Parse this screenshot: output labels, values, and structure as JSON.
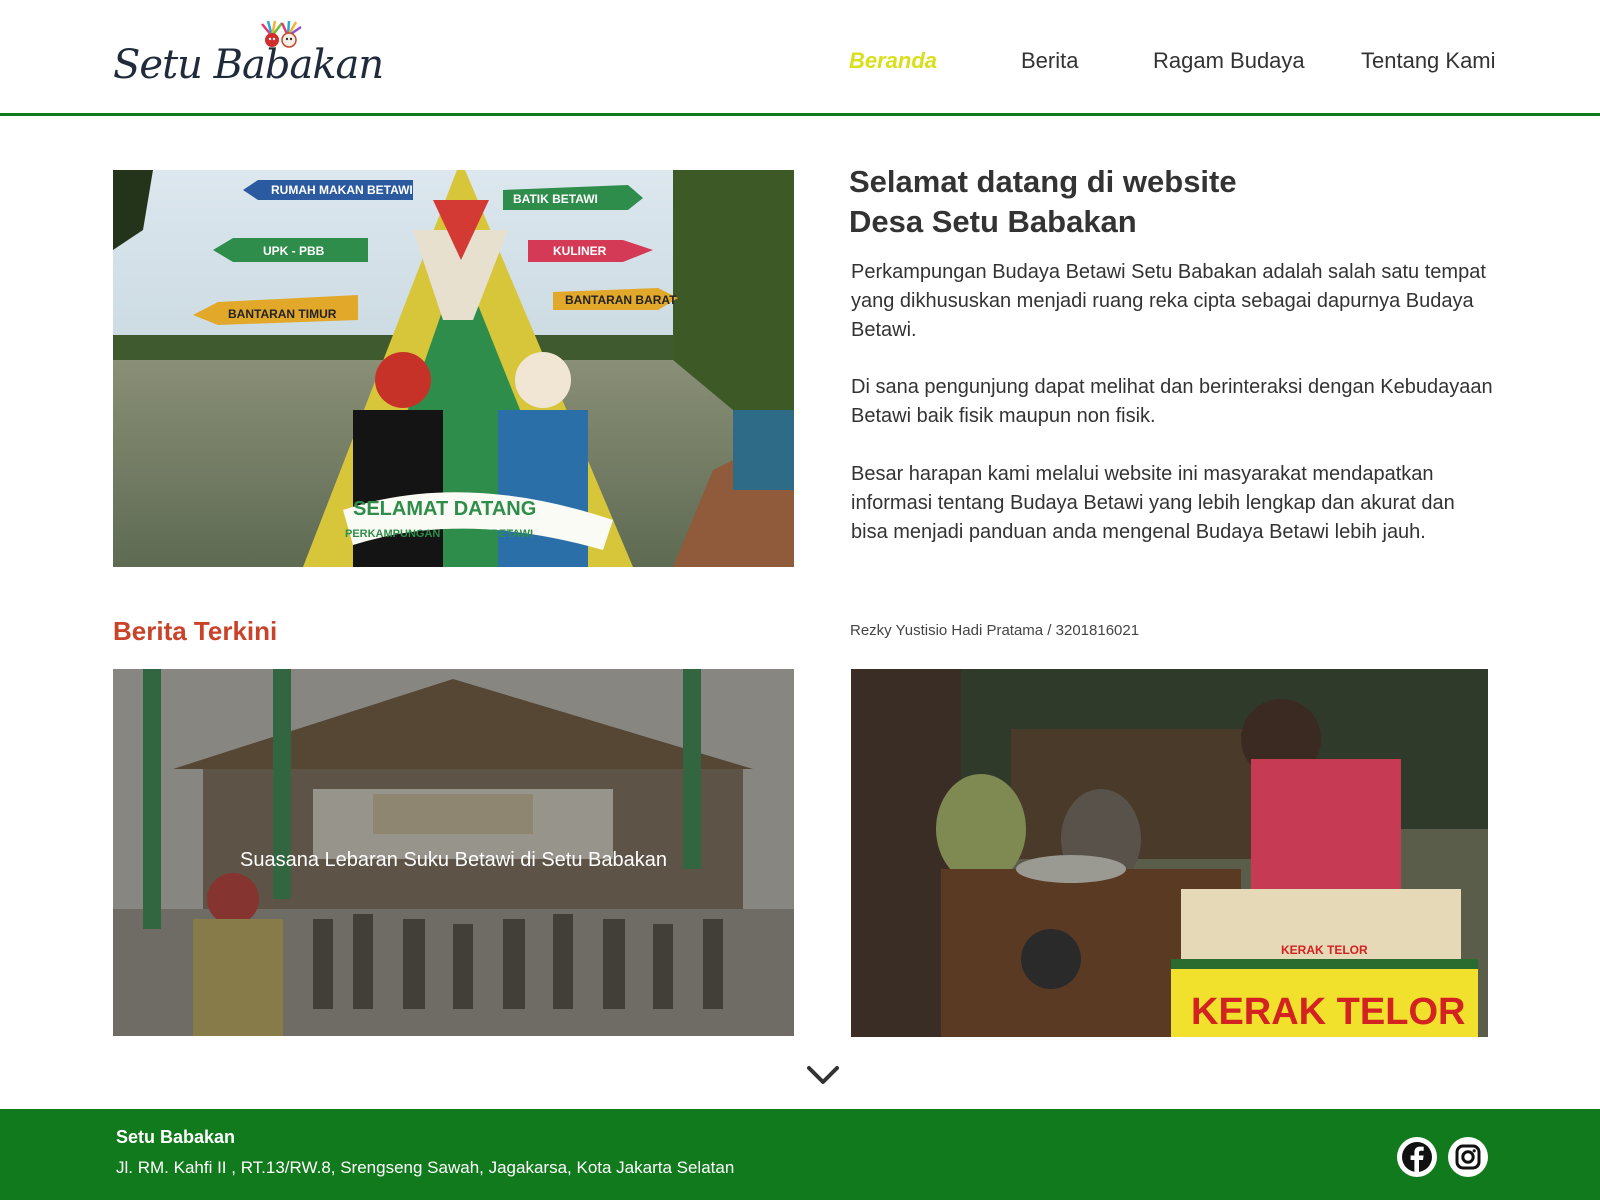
{
  "header": {
    "logo_text": "Setu Babakan",
    "nav": [
      {
        "label": "Beranda",
        "active": true
      },
      {
        "label": "Berita",
        "active": false
      },
      {
        "label": "Ragam Budaya",
        "active": false
      },
      {
        "label": "Tentang Kami",
        "active": false
      }
    ]
  },
  "hero": {
    "image_signs": [
      "RUMAH MAKAN BETAWI",
      "BATIK BETAWI",
      "UPK - PBB",
      "KULINER",
      "BANTARAN TIMUR",
      "BANTARAN BARAT",
      "SELAMAT DATANG",
      "PERKAMPUNGAN BUDAYA BETAWI"
    ],
    "title_line1": "Selamat datang di website",
    "title_line2": "Desa Setu Babakan",
    "paragraphs": [
      "Perkampungan Budaya Betawi Setu Babakan adalah salah satu tempat yang dikhususkan menjadi ruang reka cipta sebagai dapurnya Budaya Betawi.",
      "Di sana pengunjung dapat melihat dan berinteraksi dengan Kebudayaan Betawi baik fisik maupun non fisik.",
      "Besar harapan kami melalui website ini masyarakat mendapatkan informasi tentang Budaya Betawi yang lebih lengkap dan akurat dan bisa menjadi panduan anda mengenal Budaya Betawi lebih jauh."
    ]
  },
  "news": {
    "heading": "Berita Terkini",
    "author": "Rezky Yustisio Hadi Pratama / 3201816021",
    "cards": [
      {
        "caption": "Suasana Lebaran Suku Betawi di Setu Babakan"
      }
    ],
    "photo_sign": "KERAK TELOR",
    "photo_sign_small": "KERAK TELOR"
  },
  "footer": {
    "title": "Setu Babakan",
    "address": "Jl. RM. Kahfi II , RT.13/RW.8, Srengseng Sawah, Jagakarsa, Kota Jakarta Selatan",
    "social": [
      "facebook-icon",
      "instagram-icon"
    ]
  },
  "colors": {
    "brand_green": "#117a1c",
    "nav_active": "#d9df1b",
    "heading_red": "#c8432a"
  }
}
